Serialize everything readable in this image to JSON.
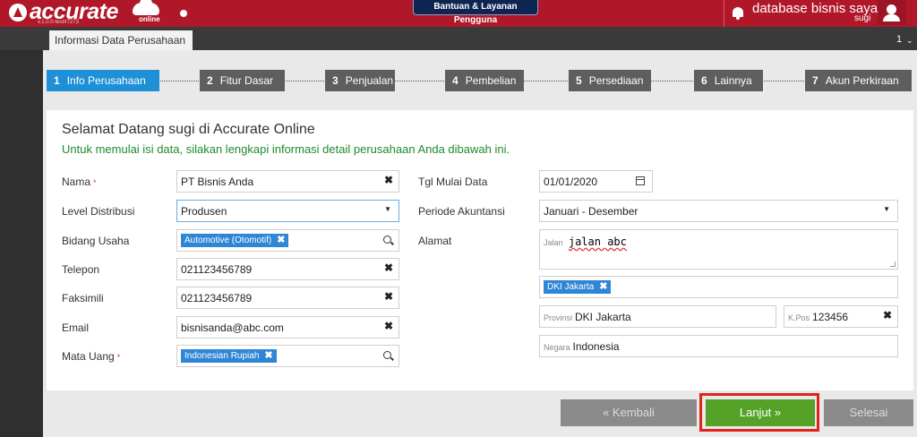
{
  "topbar": {
    "logo_text": "accurate",
    "logo_sub": "online",
    "version": "v.1.0.0-test#7273",
    "help_button": "Bantuan & Layanan Pengguna",
    "database_name": "database bisnis saya",
    "user": "sugi",
    "colors": {
      "brand": "#b0182a",
      "help": "#0e2451"
    }
  },
  "tabs": {
    "active": "Informasi Data Perusahaan",
    "count": "1"
  },
  "steps": [
    {
      "num": "1",
      "label": "Info Perusahaan",
      "active": true
    },
    {
      "num": "2",
      "label": "Fitur Dasar"
    },
    {
      "num": "3",
      "label": "Penjualan"
    },
    {
      "num": "4",
      "label": "Pembelian"
    },
    {
      "num": "5",
      "label": "Persediaan"
    },
    {
      "num": "6",
      "label": "Lainnya"
    },
    {
      "num": "7",
      "label": "Akun Perkiraan"
    }
  ],
  "form": {
    "welcome": "Selamat Datang sugi di Accurate Online",
    "subtitle": "Untuk memulai isi data, silakan lengkapi informasi detail perusahaan Anda dibawah ini.",
    "nama": {
      "label": "Nama",
      "value": "PT Bisnis Anda",
      "required": "*"
    },
    "level": {
      "label": "Level Distribusi",
      "value": "Produsen"
    },
    "bidang": {
      "label": "Bidang Usaha",
      "tag": "Automotive (Otomotif)"
    },
    "telepon": {
      "label": "Telepon",
      "value": "021123456789"
    },
    "faksimili": {
      "label": "Faksimili",
      "value": "021123456789"
    },
    "email": {
      "label": "Email",
      "value": "bisnisanda@abc.com"
    },
    "mata_uang": {
      "label": "Mata Uang",
      "tag": "Indonesian Rupiah",
      "required": "*"
    },
    "tgl_mulai": {
      "label": "Tgl Mulai Data",
      "value": "01/01/2020"
    },
    "periode": {
      "label": "Periode Akuntansi",
      "value": "Januari - Desember"
    },
    "alamat": {
      "label": "Alamat",
      "jalan_label": "Jalan",
      "jalan_value": "jalan abc",
      "kota_tag": "DKI Jakarta",
      "provinsi_label": "Provinsi",
      "provinsi_value": "DKI Jakarta",
      "kpos_label": "K.Pos",
      "kpos_value": "123456",
      "negara_label": "Negara",
      "negara_value": "Indonesia"
    }
  },
  "buttons": {
    "back": "« Kembali",
    "next": "Lanjut »",
    "done": "Selesai"
  },
  "icons": {
    "clear": "✖",
    "remove_tag": "✖",
    "caret": "▼"
  }
}
